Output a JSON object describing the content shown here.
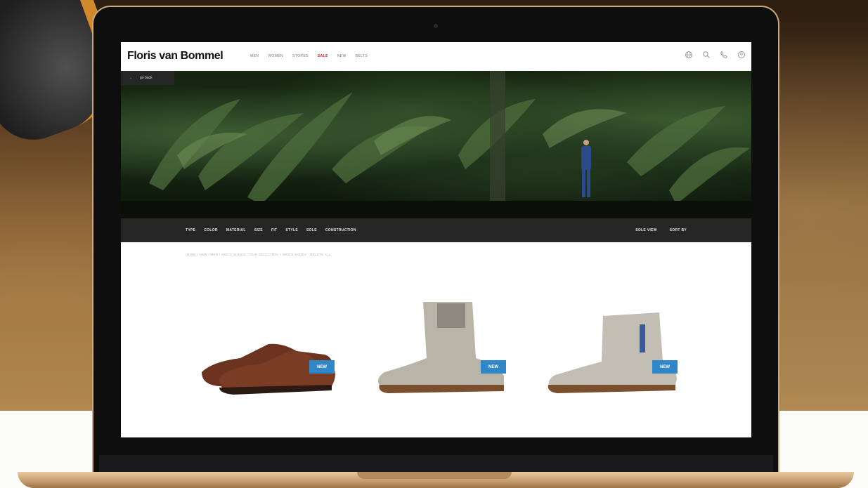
{
  "brand": {
    "logo_text": "Floris van Bommel"
  },
  "nav": {
    "items": [
      {
        "label": "MEN"
      },
      {
        "label": "WOMEN"
      },
      {
        "label": "STORES"
      },
      {
        "label": "SALE"
      },
      {
        "label": "NEW"
      },
      {
        "label": "BELTS"
      }
    ]
  },
  "toolbar_icons": [
    "globe-icon",
    "search-icon",
    "phone-icon",
    "user-icon"
  ],
  "hero": {
    "back_label": "go back"
  },
  "filters": {
    "items": [
      {
        "label": "TYPE"
      },
      {
        "label": "COLOR"
      },
      {
        "label": "MATERIAL"
      },
      {
        "label": "SIZE"
      },
      {
        "label": "FIT"
      },
      {
        "label": "STYLE"
      },
      {
        "label": "SOLE"
      },
      {
        "label": "CONSTRUCTION"
      }
    ],
    "sole_view": "SOLE VIEW",
    "sort_by": "SORT BY"
  },
  "breadcrumb": "HOME / NEW / MEN / MEN'S SHOES: YOUR SELECTION     ×  MEN'S SHOES · DELETE ALL",
  "products": [
    {
      "name": "brown-leather-derby",
      "badge": "NEW"
    },
    {
      "name": "grey-suede-lace-boot",
      "badge": "NEW"
    },
    {
      "name": "grey-suede-chelsea-boot",
      "badge": "NEW"
    }
  ],
  "colors": {
    "accent_sale": "#d8232a",
    "badge": "#2f86c9",
    "filterbar": "#262626"
  }
}
